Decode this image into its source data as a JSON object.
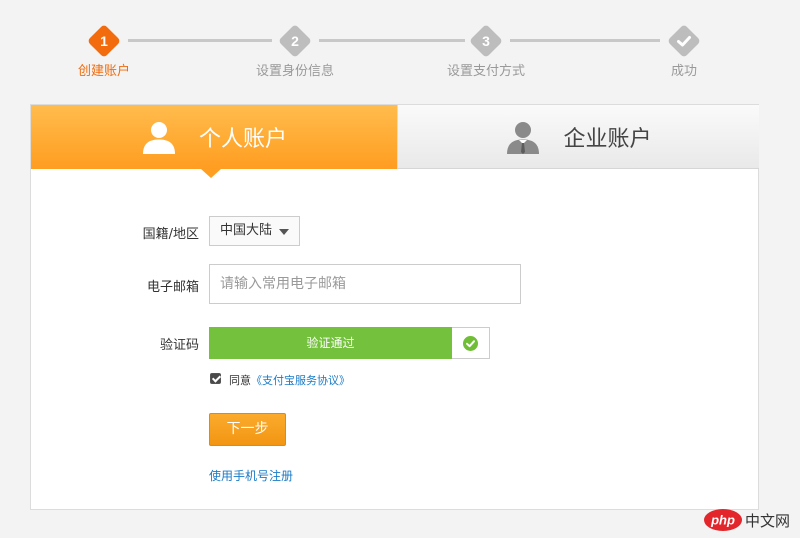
{
  "steps": [
    {
      "num": "1",
      "label": "创建账户",
      "state": "active"
    },
    {
      "num": "2",
      "label": "设置身份信息",
      "state": "pending"
    },
    {
      "num": "3",
      "label": "设置支付方式",
      "state": "pending"
    },
    {
      "icon": "check-icon",
      "label": "成功",
      "state": "pending"
    }
  ],
  "tabs": {
    "personal": {
      "label": "个人账户",
      "icon": "person-icon",
      "selected": true
    },
    "enterprise": {
      "label": "企业账户",
      "icon": "business-person-icon",
      "selected": false
    }
  },
  "form": {
    "region_label": "国籍/地区",
    "region_value": "中国大陆",
    "email_label": "电子邮箱",
    "email_placeholder": "请输入常用电子邮箱",
    "email_value": "",
    "captcha_label": "验证码",
    "captcha_status": "验证通过",
    "agree_checked": true,
    "agree_prefix": "同意",
    "agree_link": "《支付宝服务协议》",
    "next_button": "下一步",
    "phone_link": "使用手机号注册"
  },
  "colors": {
    "accent": "#f26b0d",
    "tab_active": "#ff9d20",
    "success": "#73c13c",
    "link": "#1a7bc6"
  },
  "watermark": {
    "brand": "php",
    "text": "中文网"
  }
}
